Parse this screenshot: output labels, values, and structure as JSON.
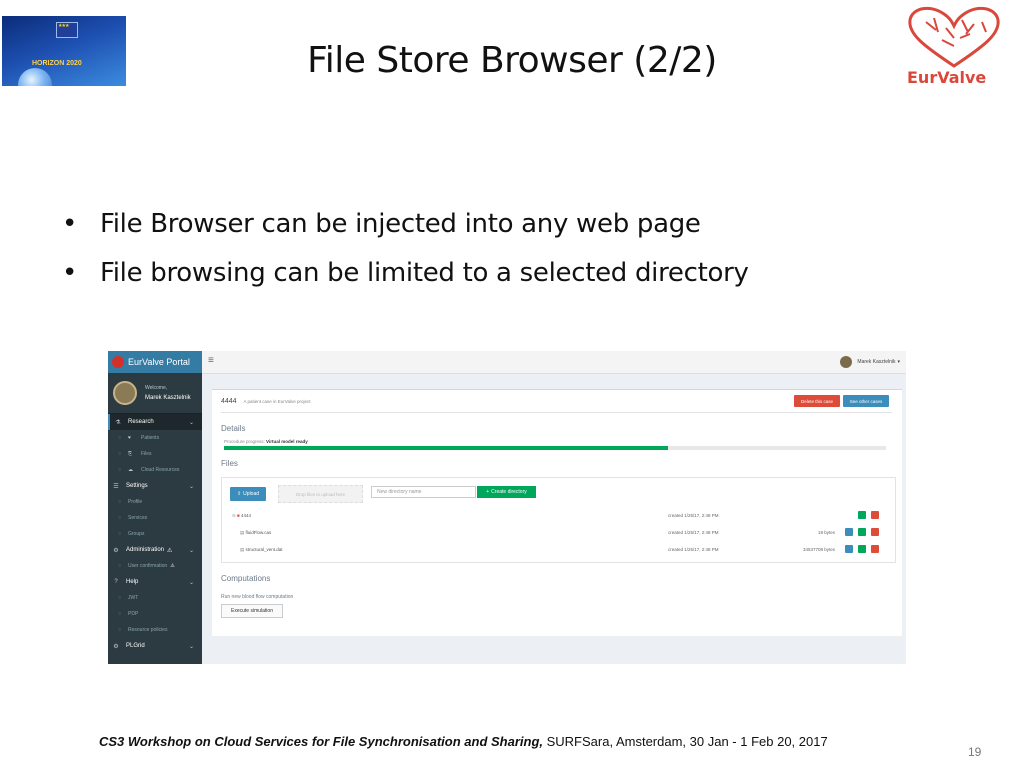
{
  "slide": {
    "title": "File Store Browser (2/2)",
    "bullets": [
      "File Browser can be injected into any web page",
      "File browsing can be limited to a selected directory"
    ],
    "footer_italic": "CS3 Workshop on Cloud Services for File Synchronisation and Sharing,",
    "footer_rest": " SURFSara,  Amsterdam, 30 Jan - 1 Feb 20, 2017",
    "page_number": "19",
    "horizon_label": "HORIZON 2020",
    "eurvalve_logo_text": "EurValve"
  },
  "portal": {
    "brand": "EurValve Portal",
    "welcome": "Welcome,",
    "user_name": "Marek Kasztelnik",
    "top_user": "Marek Kasztelnik",
    "menu": [
      {
        "label": "Research",
        "icon": "flask-icon",
        "glyph": "⚗",
        "active": true
      },
      {
        "label": "Settings",
        "icon": "sliders-icon",
        "glyph": "☰"
      },
      {
        "label": "Administration",
        "icon": "cogs-icon",
        "glyph": "⚙",
        "warn": true
      },
      {
        "label": "Help",
        "icon": "question-icon",
        "glyph": "❓"
      },
      {
        "label": "PLGrid",
        "icon": "cogs-icon",
        "glyph": "⚙"
      }
    ],
    "research_items": [
      {
        "label": "Patients",
        "glyph": "♥"
      },
      {
        "label": "Files",
        "glyph": "⎘"
      },
      {
        "label": "Cloud Resources",
        "glyph": "☁"
      }
    ],
    "settings_items": [
      "Profile",
      "Services",
      "Groups"
    ],
    "admin_items": [
      "User confirmation"
    ],
    "help_items": [
      "JWT",
      "PDP",
      "Resource policies"
    ],
    "case": {
      "id": "4444",
      "description": "A patient case in EurValve project",
      "delete_label": "Delete this case",
      "other_label": "See other cases",
      "details_heading": "Details",
      "progress_prefix": "Procedure progress:",
      "progress_status": "Virtual model ready",
      "progress_fraction": 0.67
    },
    "files": {
      "heading": "Files",
      "upload_label": "Upload",
      "drop_label": "Drop files to upload here",
      "new_dir_placeholder": "New directory name",
      "create_dir_label": "Create directory",
      "rows": [
        {
          "name": "4444",
          "type": "folder",
          "created": "created 1/25/17, 2:48 PM",
          "size": ""
        },
        {
          "name": "fluidFlow.cas",
          "type": "file",
          "created": "created 1/25/17, 2:48 PM",
          "size": "19 bytes"
        },
        {
          "name": "structural_vent.dat",
          "type": "file",
          "created": "created 1/25/17, 2:48 PM",
          "size": "34537708 bytes"
        }
      ]
    },
    "computations": {
      "heading": "Computations",
      "run_label": "Run new blood flow computation",
      "execute_label": "Execute simulation"
    }
  },
  "colors": {
    "sidebar": "#2c3b41",
    "header": "#357ca5",
    "danger": "#dd4b39",
    "primary": "#3c8dbc",
    "success": "#00a65a"
  }
}
